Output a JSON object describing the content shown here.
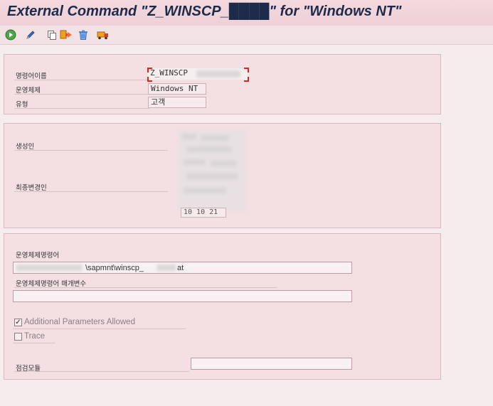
{
  "window": {
    "title": "External Command \"Z_WINSCP_████\" for \"Windows NT\""
  },
  "toolbar": {
    "items": [
      {
        "icon": "execute-icon"
      },
      {
        "icon": "pencil-icon"
      },
      {
        "icon": "copy-icon"
      },
      {
        "icon": "rename-icon"
      },
      {
        "icon": "trash-icon"
      },
      {
        "icon": "transport-truck-icon"
      }
    ]
  },
  "header_section": {
    "command_name_label": "명령어이름",
    "command_name_value": "Z_WINSCP",
    "os_label": "운영체제",
    "os_value": "Windows NT",
    "type_label": "유형",
    "type_value": "고객"
  },
  "admin_section": {
    "created_by_label": "생성인",
    "last_changed_by_label": "최종변경인",
    "partial_value": "10 10 21"
  },
  "command_section": {
    "os_command_label": "운영체제명령어",
    "os_command_value": "\\sapmnt\\winscp_",
    "os_command_suffix": "at",
    "parameters_label": "운영체제명령어 매개변수",
    "parameters_value": "",
    "additional_params_label": "Additional Parameters Allowed",
    "additional_params_checked": true,
    "trace_label": "Trace",
    "trace_checked": false,
    "check_module_label": "점검모듈",
    "check_module_value": ""
  },
  "colors": {
    "background": "#f6ecee",
    "panel": "#f4dfe3",
    "title_text": "#1e2a4a",
    "focus_marker": "#dd2222"
  }
}
